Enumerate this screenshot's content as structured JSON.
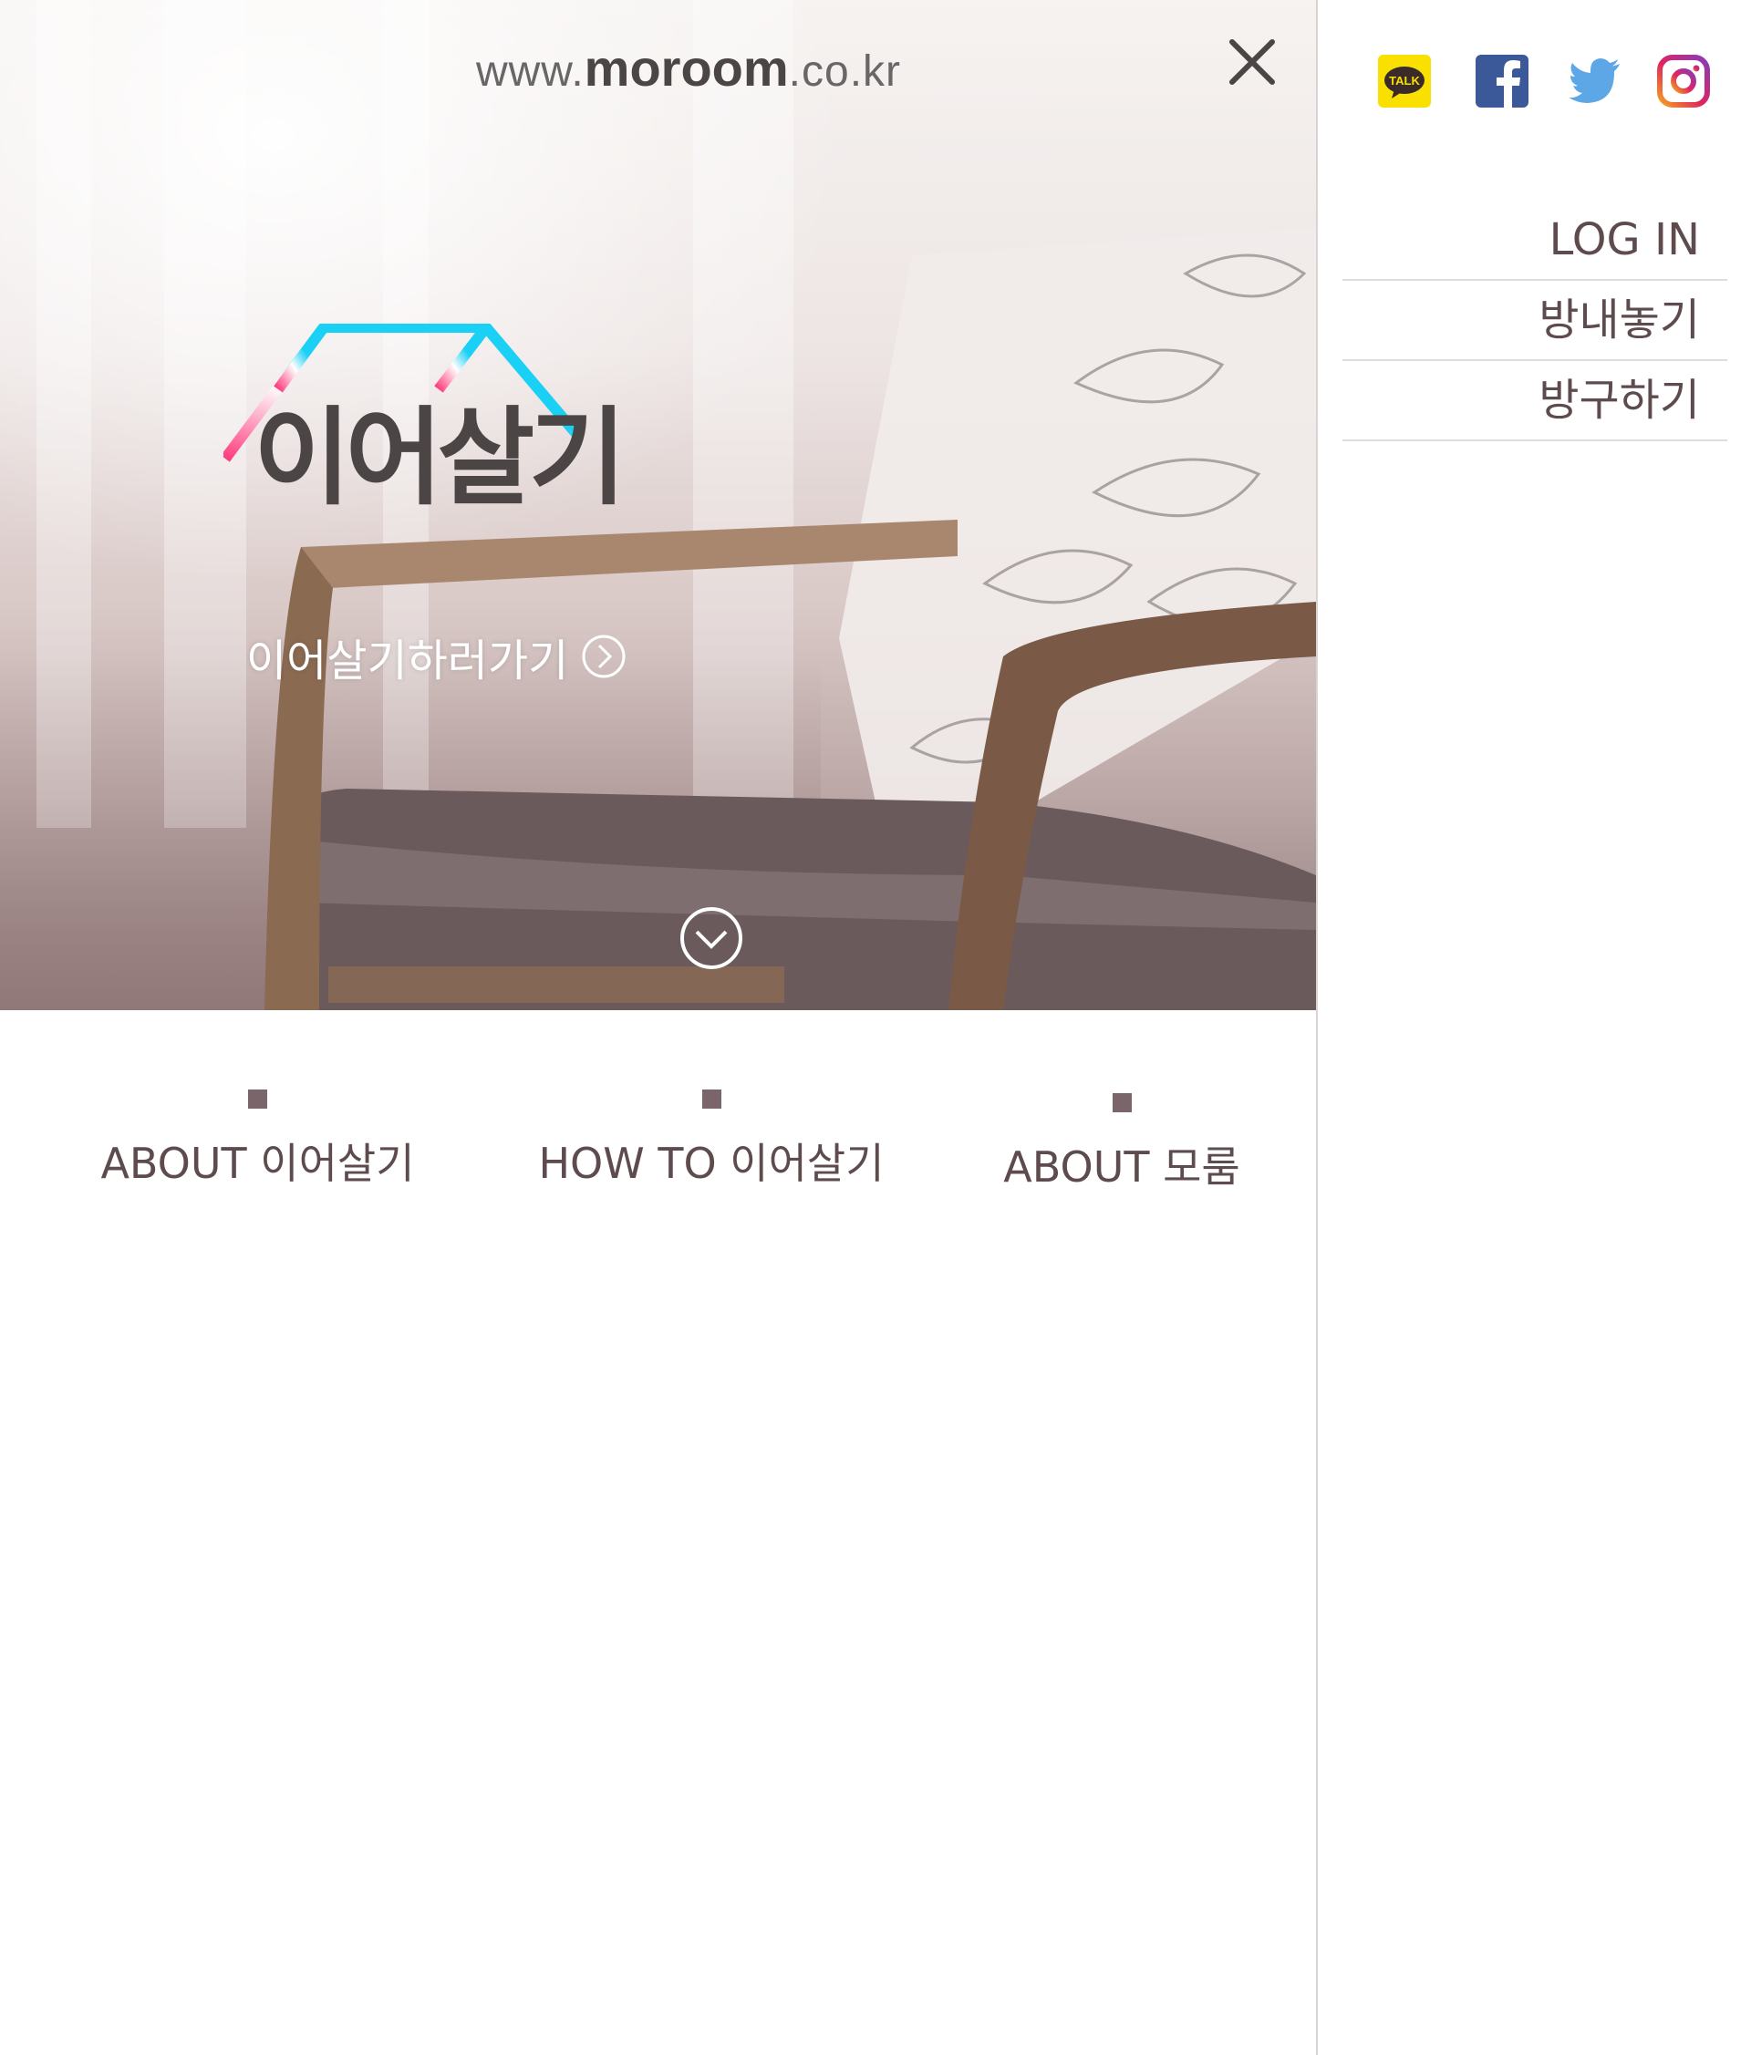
{
  "hero": {
    "url_prefix": "www.",
    "url_brand": "moroom",
    "url_suffix": ".co.kr",
    "logo_text": "이어살기",
    "cta_label": "이어살기하러가기"
  },
  "section_nav": [
    {
      "label": "ABOUT 이어살기"
    },
    {
      "label": "HOW TO  이어살기"
    },
    {
      "label": "ABOUT 모룸"
    }
  ],
  "social": [
    {
      "name": "kakaotalk-icon",
      "text": "TALK",
      "color": "#f9e000"
    },
    {
      "name": "facebook-icon",
      "color": "#3b5998"
    },
    {
      "name": "twitter-icon",
      "color": "#5ea7e6"
    },
    {
      "name": "instagram-icon",
      "color": "#c13584"
    }
  ],
  "menu": [
    {
      "label": "LOG IN"
    },
    {
      "label": "방내놓기"
    },
    {
      "label": "방구하기"
    }
  ],
  "colors": {
    "text": "#5e4b4d",
    "marker": "#7a666a",
    "logo_pink": "#ff3d7f",
    "logo_cyan": "#1ad0f5"
  }
}
